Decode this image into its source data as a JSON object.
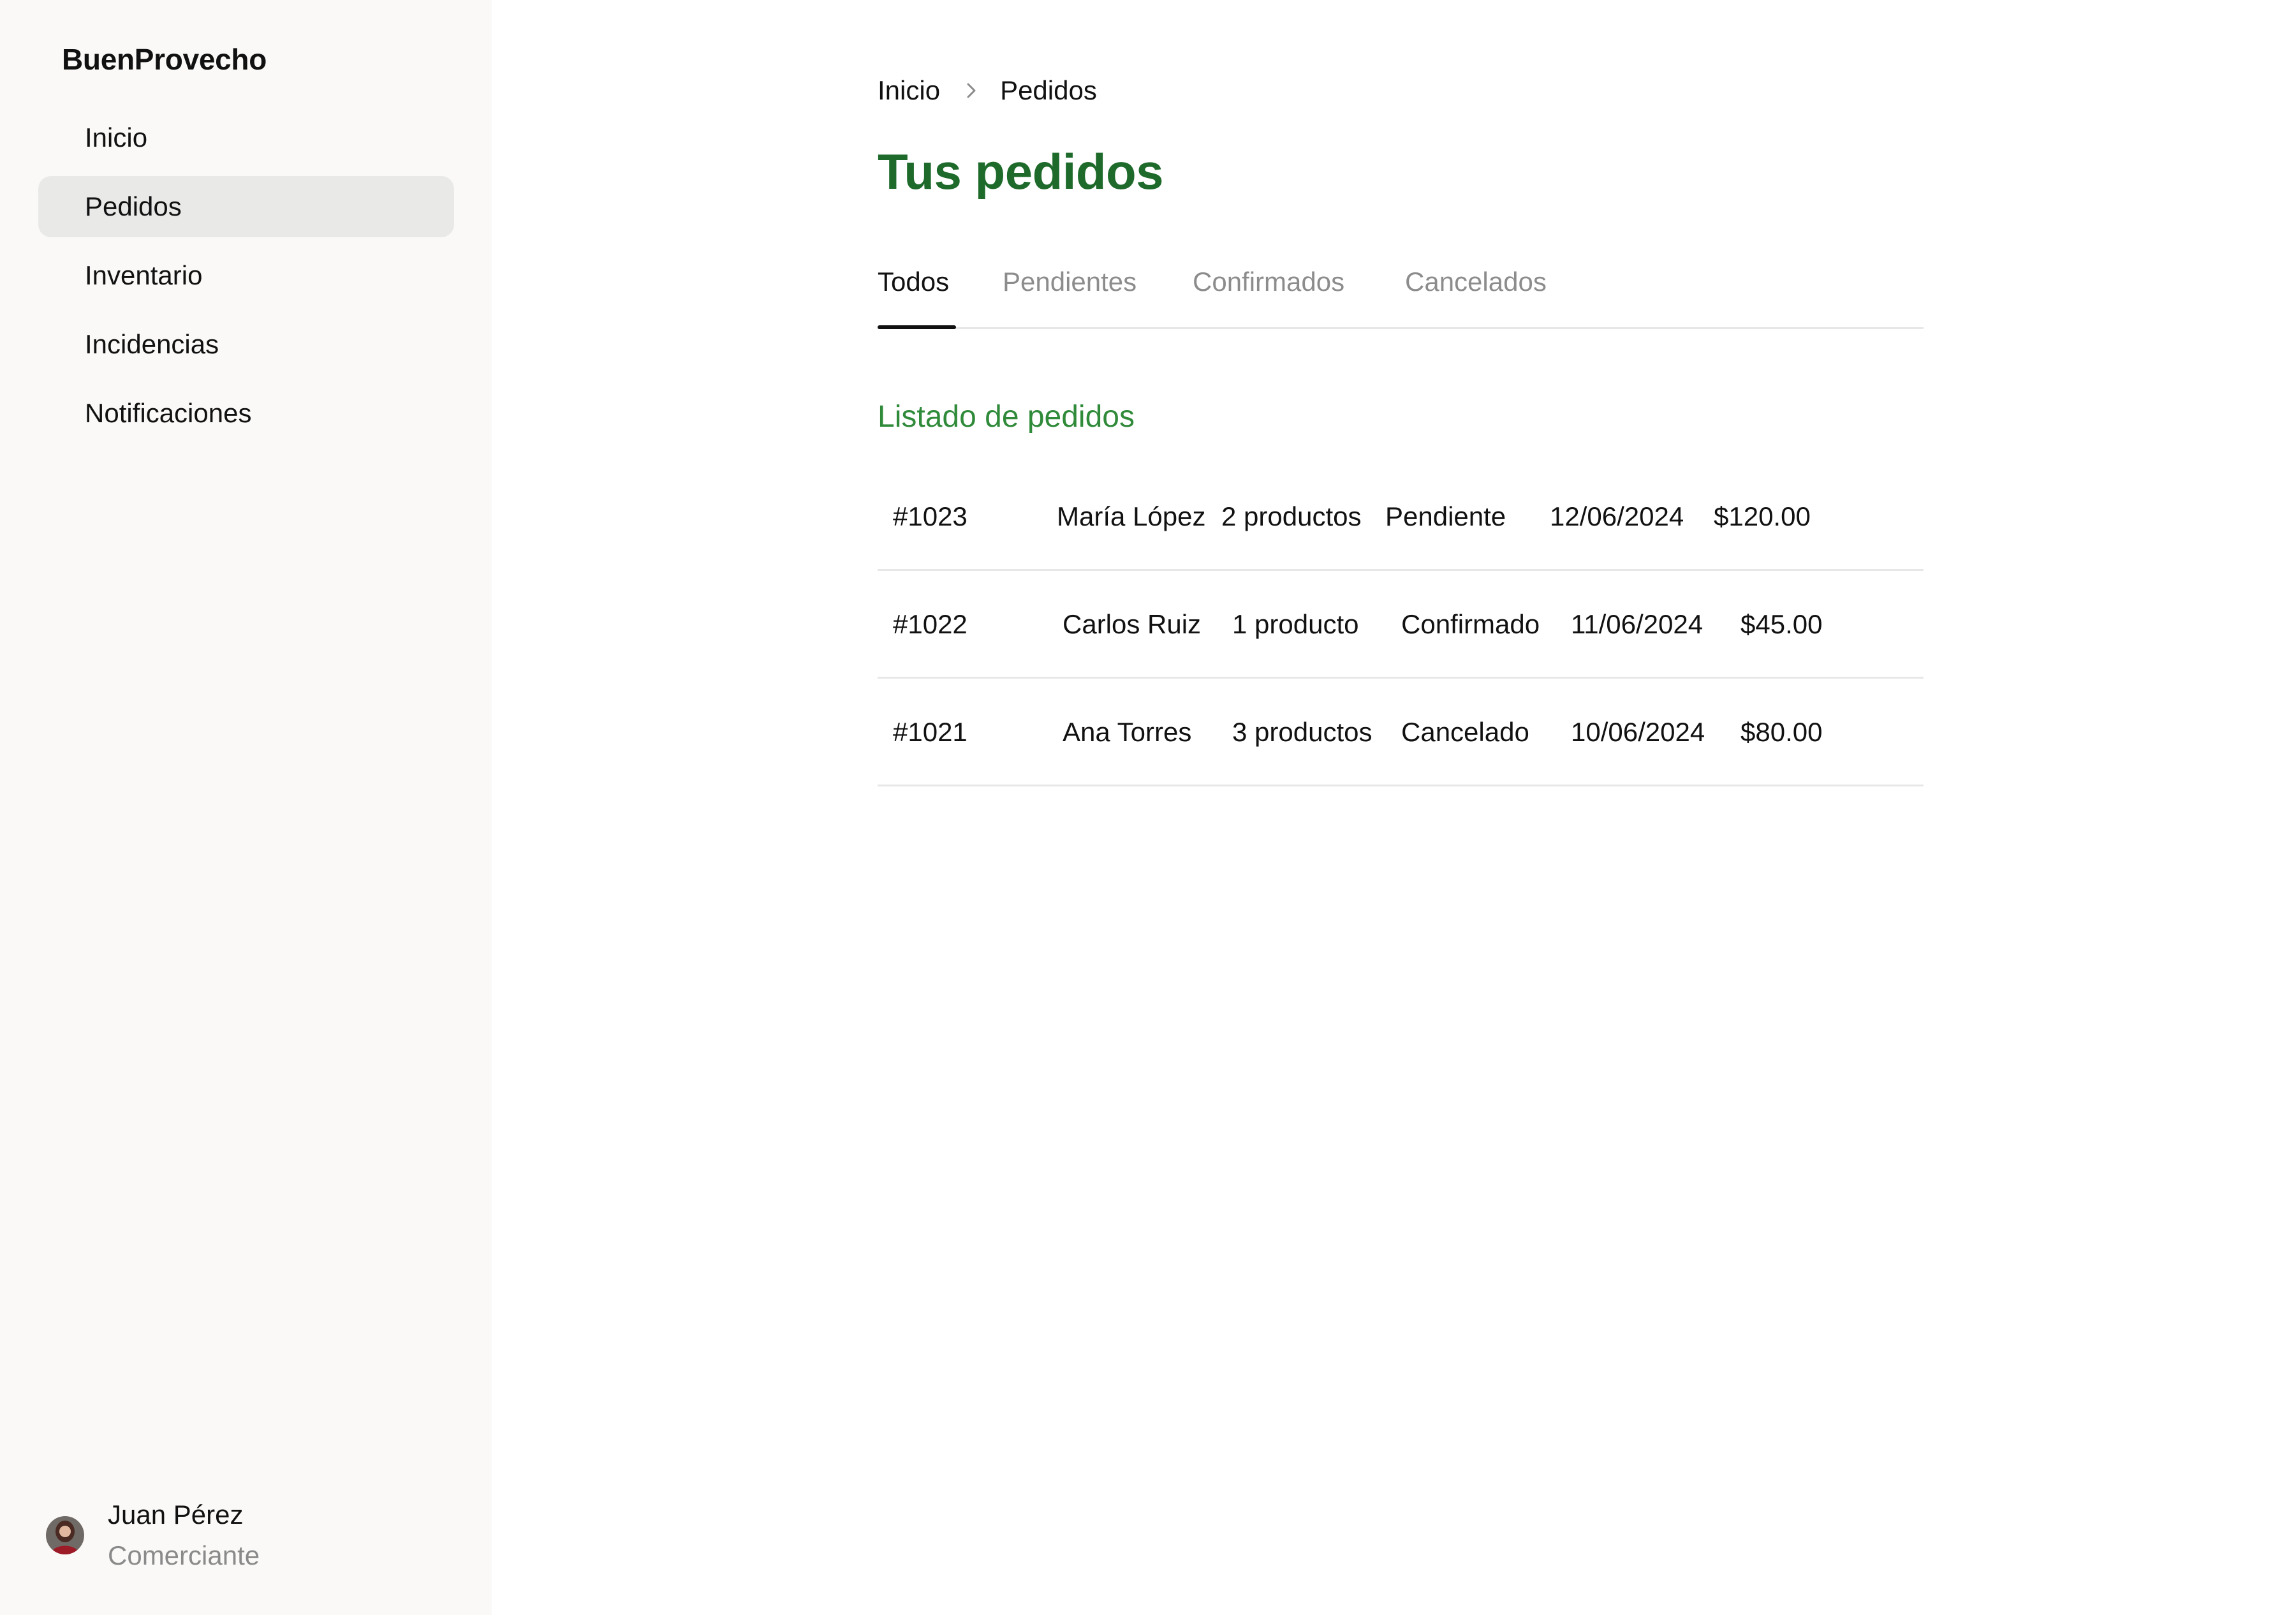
{
  "sidebar": {
    "brand": "BuenProvecho",
    "items": [
      {
        "label": "Inicio",
        "active": false
      },
      {
        "label": "Pedidos",
        "active": true
      },
      {
        "label": "Inventario",
        "active": false
      },
      {
        "label": "Incidencias",
        "active": false
      },
      {
        "label": "Notificaciones",
        "active": false
      }
    ],
    "user": {
      "name": "Juan Pérez",
      "role": "Comerciante",
      "avatar_icon": "user-avatar-photo"
    }
  },
  "breadcrumb": {
    "items": [
      "Inicio",
      "Pedidos"
    ],
    "separator_icon": "chevron-right-icon"
  },
  "page": {
    "title": "Tus pedidos"
  },
  "tabs": [
    {
      "label": "Todos",
      "active": true
    },
    {
      "label": "Pendientes",
      "active": false
    },
    {
      "label": "Confirmados",
      "active": false
    },
    {
      "label": "Cancelados",
      "active": false
    }
  ],
  "orders": {
    "title": "Listado de pedidos",
    "rows": [
      {
        "id": "#1023",
        "customer": "María López",
        "items": "2 productos",
        "status": "Pendiente",
        "date": "12/06/2024",
        "total": "$120.00"
      },
      {
        "id": "#1022",
        "customer": "Carlos Ruiz",
        "items": "1 producto",
        "status": "Confirmado",
        "date": "11/06/2024",
        "total": "$45.00"
      },
      {
        "id": "#1021",
        "customer": "Ana Torres",
        "items": "3 productos",
        "status": "Cancelado",
        "date": "10/06/2024",
        "total": "$80.00"
      }
    ]
  },
  "colors": {
    "title_green": "#1d6a2a",
    "section_green": "#2f8a3a",
    "sidebar_bg": "#faf9f7",
    "active_nav_bg": "#e9e9e8",
    "muted_text": "#8c8c8c"
  }
}
